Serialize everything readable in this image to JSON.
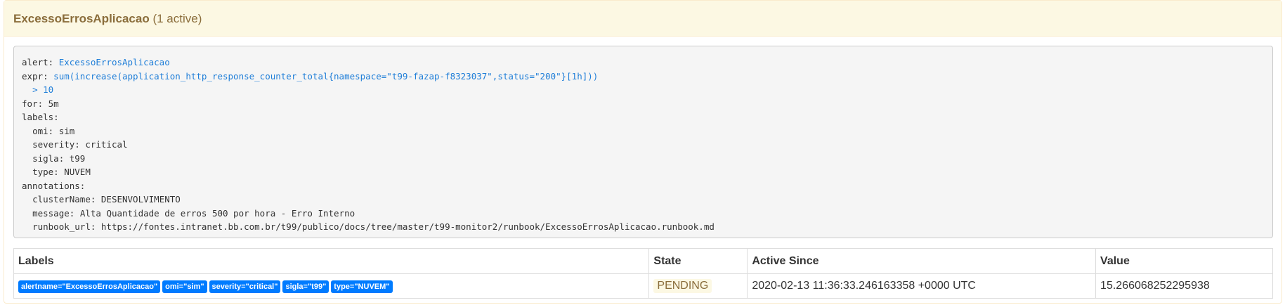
{
  "alert_panel": {
    "name": "ExcessoErrosAplicacao",
    "active_count": "(1 active)"
  },
  "rule": {
    "alert_key": "alert:",
    "alert_value": "ExcessoErrosAplicacao",
    "expr_key": "expr:",
    "expr_value_line1": "sum(increase(application_http_response_counter_total{namespace=\"t99-fazap-f8323037\",status=\"200\"}[1h]))",
    "expr_value_line2": "> 10",
    "for_key": "for:",
    "for_value": "5m",
    "labels_key": "labels:",
    "labels": [
      {
        "key": "omi:",
        "value": "sim"
      },
      {
        "key": "severity:",
        "value": "critical"
      },
      {
        "key": "sigla:",
        "value": "t99"
      },
      {
        "key": "type:",
        "value": "NUVEM"
      }
    ],
    "annotations_key": "annotations:",
    "annotations": [
      {
        "key": "clusterName:",
        "value": "DESENVOLVIMENTO"
      },
      {
        "key": "message:",
        "value": "Alta Quantidade de erros 500 por hora - Erro Interno"
      },
      {
        "key": "runbook_url:",
        "value": "https://fontes.intranet.bb.com.br/t99/publico/docs/tree/master/t99-monitor2/runbook/ExcessoErrosAplicacao.runbook.md"
      }
    ]
  },
  "table": {
    "headers": {
      "labels": "Labels",
      "state": "State",
      "active_since": "Active Since",
      "value": "Value"
    },
    "rows": [
      {
        "badges": [
          "alertname=\"ExcessoErrosAplicacao\"",
          "omi=\"sim\"",
          "severity=\"critical\"",
          "sigla=\"t99\"",
          "type=\"NUVEM\""
        ],
        "state": "PENDING",
        "active_since": "2020-02-13 11:36:33.246163358 +0000 UTC",
        "value": "15.266068252295938"
      }
    ]
  },
  "colors": {
    "warning_bg": "#fcf8e3",
    "warning_text": "#8a6d3b",
    "badge_bg": "#007bff",
    "expr_blue": "#1f7ed8"
  }
}
